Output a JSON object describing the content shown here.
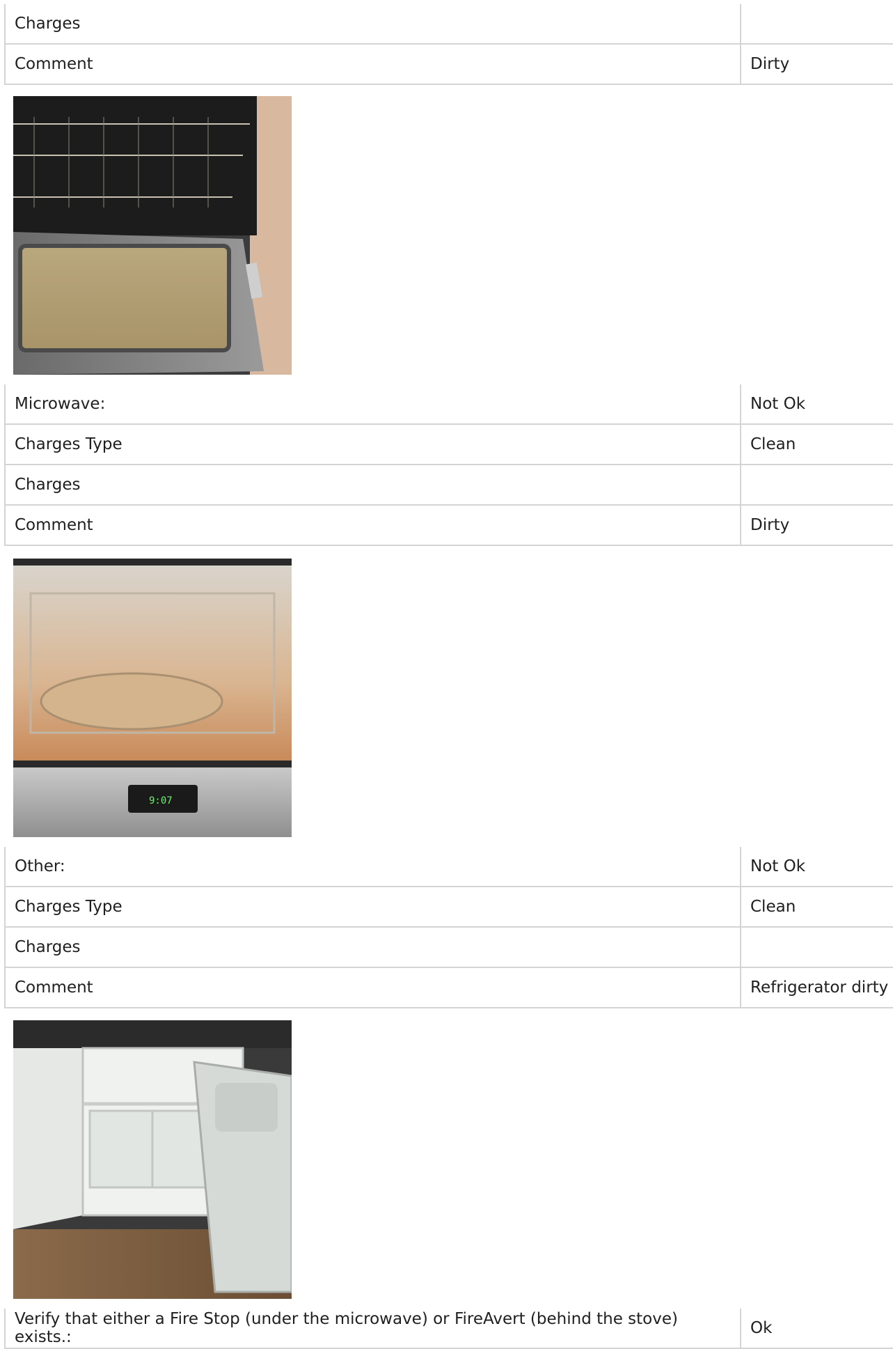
{
  "sections": [
    {
      "rows": [
        {
          "label": "Charges",
          "value": ""
        },
        {
          "label": "Comment",
          "value": "Dirty"
        }
      ],
      "photo_icon": "oven-photo"
    },
    {
      "rows": [
        {
          "label": "Microwave:",
          "value": "Not Ok"
        },
        {
          "label": "Charges Type",
          "value": "Clean"
        },
        {
          "label": "Charges",
          "value": ""
        },
        {
          "label": "Comment",
          "value": "Dirty"
        }
      ],
      "photo_icon": "microwave-photo",
      "photo_display": "9:07"
    },
    {
      "rows": [
        {
          "label": "Other:",
          "value": "Not Ok"
        },
        {
          "label": "Charges Type",
          "value": "Clean"
        },
        {
          "label": "Charges",
          "value": ""
        },
        {
          "label": "Comment",
          "value": "Refrigerator dirty"
        }
      ],
      "photo_icon": "refrigerator-photo"
    },
    {
      "rows": [
        {
          "label": "Verify that either a Fire Stop (under the microwave) or FireAvert (behind the stove) exists.:",
          "value": "Ok"
        }
      ]
    }
  ]
}
